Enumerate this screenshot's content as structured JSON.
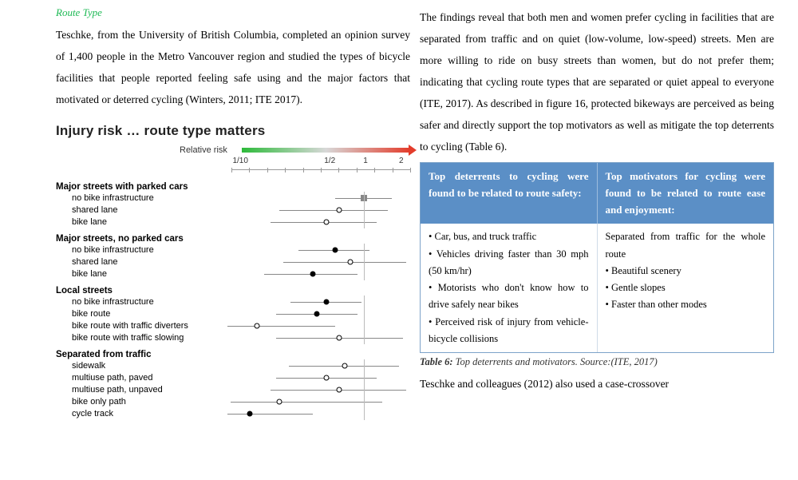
{
  "heading": "Route Type",
  "col1_para": "Teschke, from the University of British Columbia, completed an opinion survey of 1,400 people in the Metro Vancouver region and studied the types of bicycle facilities that people reported feeling safe using and the major factors that motivated or deterred cycling (Winters, 2011; ITE 2017).",
  "col2_para": "The findings reveal that both men and women prefer cycling in facilities that are separated from traffic and on quiet (low-volume, low-speed) streets. Men are more willing to ride on busy streets than women, but do not prefer them; indicating that cycling route types that are separated or quiet appeal to everyone (ITE, 2017). As described in figure 16, protected bikeways are perceived as being safer and directly support the top motivators as well as mitigate the top deterrents to cycling (Table 6).",
  "col2_tail": "Teschke and colleagues (2012) also used a case-crossover",
  "chart_data": {
    "type": "forest",
    "title": "Injury risk … route type matters",
    "axis_label": "Relative risk",
    "ticks": [
      "1/10",
      "1/2",
      "1",
      "2"
    ],
    "tick_positions_pct": [
      5,
      55,
      75,
      95
    ],
    "refline_pct": 75,
    "groups": [
      {
        "name": "Major streets with parked cars",
        "rows": [
          {
            "label": "no bike infrastructure",
            "pt_pct": 75,
            "filled": false,
            "square": true,
            "ci": [
              60,
              90
            ]
          },
          {
            "label": "shared lane",
            "pt_pct": 62,
            "filled": false,
            "ci": [
              30,
              88
            ]
          },
          {
            "label": "bike lane",
            "pt_pct": 55,
            "filled": false,
            "ci": [
              25,
              82
            ]
          }
        ]
      },
      {
        "name": "Major streets, no parked cars",
        "rows": [
          {
            "label": "no bike infrastructure",
            "pt_pct": 60,
            "filled": true,
            "ci": [
              40,
              78
            ]
          },
          {
            "label": "shared lane",
            "pt_pct": 68,
            "filled": false,
            "ci": [
              32,
              98
            ]
          },
          {
            "label": "bike lane",
            "pt_pct": 48,
            "filled": true,
            "ci": [
              22,
              72
            ]
          }
        ]
      },
      {
        "name": "Local streets",
        "rows": [
          {
            "label": "no bike infrastructure",
            "pt_pct": 55,
            "filled": true,
            "ci": [
              36,
              74
            ]
          },
          {
            "label": "bike route",
            "pt_pct": 50,
            "filled": true,
            "ci": [
              28,
              72
            ]
          },
          {
            "label": "bike route with traffic diverters",
            "pt_pct": 18,
            "filled": false,
            "ci": [
              2,
              60
            ]
          },
          {
            "label": "bike route with traffic slowing",
            "pt_pct": 62,
            "filled": false,
            "ci": [
              28,
              96
            ]
          }
        ]
      },
      {
        "name": "Separated from traffic",
        "rows": [
          {
            "label": "sidewalk",
            "pt_pct": 65,
            "filled": false,
            "ci": [
              35,
              94
            ]
          },
          {
            "label": "multiuse path, paved",
            "pt_pct": 55,
            "filled": false,
            "ci": [
              28,
              82
            ]
          },
          {
            "label": "multiuse path, unpaved",
            "pt_pct": 62,
            "filled": false,
            "ci": [
              25,
              98
            ]
          },
          {
            "label": "bike only path",
            "pt_pct": 30,
            "filled": false,
            "ci": [
              4,
              85
            ]
          },
          {
            "label": "cycle track",
            "pt_pct": 14,
            "filled": true,
            "ci": [
              2,
              48
            ]
          }
        ]
      }
    ]
  },
  "table6": {
    "header_left": "Top deterrents to cycling were found to be related to route safety:",
    "header_right": "Top motivators for cycling were found to be related to route ease and enjoyment:",
    "left_items": "• Car, bus, and truck traffic\n• Vehicles driving faster than 30 mph (50 km/hr)\n• Motorists who don't know how to drive safely near bikes\n• Perceived risk of injury from vehicle-bicycle collisions",
    "right_items": "Separated from traffic for the whole route\n• Beautiful scenery\n• Gentle slopes\n• Faster than other modes",
    "caption_bold": "Table 6:",
    "caption_rest": " Top deterrents and motivators. Source:(ITE, 2017)"
  }
}
